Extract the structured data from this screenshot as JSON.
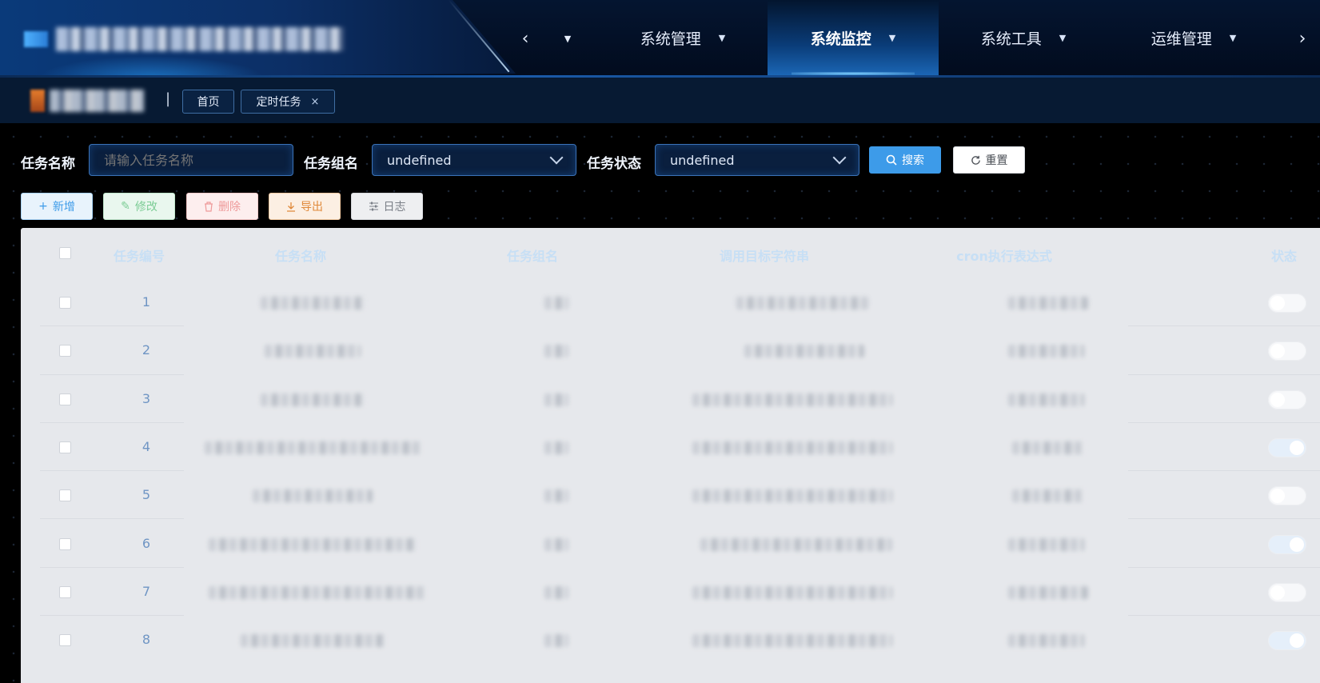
{
  "header": {
    "nav_items": [
      {
        "label": "系统管理",
        "active": false
      },
      {
        "label": "系统监控",
        "active": true
      },
      {
        "label": "系统工具",
        "active": false
      },
      {
        "label": "运维管理",
        "active": false
      }
    ],
    "prev_arrow": "‹",
    "next_arrow": "›"
  },
  "tabs": {
    "separator": "|",
    "items": [
      {
        "label": "首页",
        "closable": false
      },
      {
        "label": "定时任务",
        "closable": true,
        "close": "×"
      }
    ]
  },
  "search": {
    "task_name_label": "任务名称",
    "task_name_placeholder": "请输入任务名称",
    "task_group_label": "任务组名",
    "task_group_value": "undefined",
    "task_status_label": "任务状态",
    "task_status_value": "undefined",
    "search_button": "搜索",
    "reset_button": "重置"
  },
  "actions": {
    "add": "新增",
    "edit": "修改",
    "delete": "删除",
    "export": "导出",
    "log": "日志"
  },
  "table": {
    "columns": [
      "任务编号",
      "任务名称",
      "任务组名",
      "调用目标字符串",
      "cron执行表达式",
      "状态"
    ],
    "rows": [
      {
        "id": "1",
        "status_on": false
      },
      {
        "id": "2",
        "status_on": false
      },
      {
        "id": "3",
        "status_on": false
      },
      {
        "id": "4",
        "status_on": true
      },
      {
        "id": "5",
        "status_on": false
      },
      {
        "id": "6",
        "status_on": true
      },
      {
        "id": "7",
        "status_on": false
      },
      {
        "id": "8",
        "status_on": true
      }
    ]
  },
  "colors": {
    "primary": "#3d9be9",
    "header_bg": "#041530",
    "nav_active": "#1b66b5",
    "table_bg": "#e6e8ec"
  }
}
